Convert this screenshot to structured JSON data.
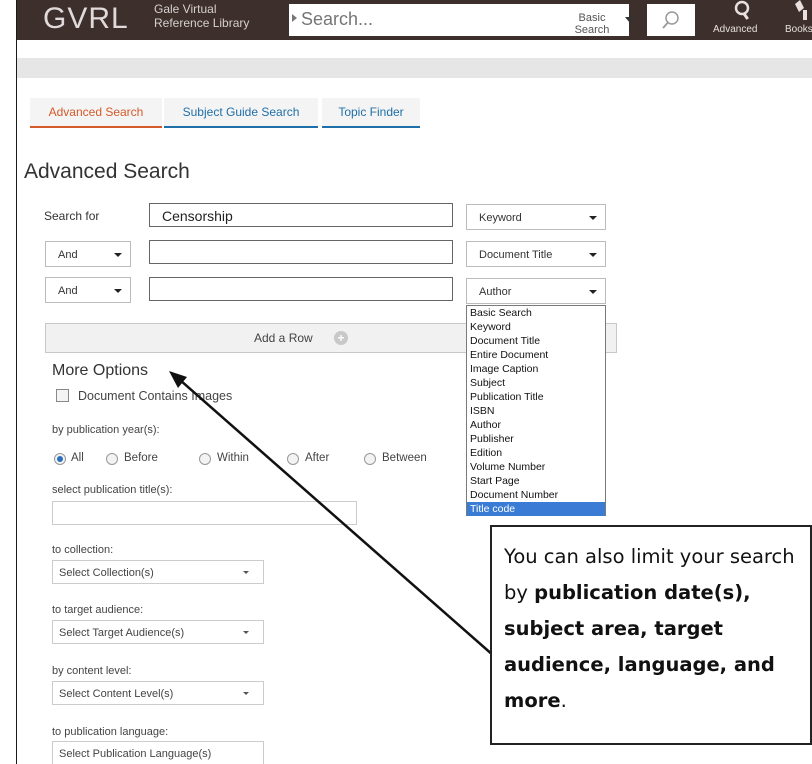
{
  "header": {
    "logo": "GVRL",
    "logo_sub_line1": "Gale Virtual",
    "logo_sub_line2": "Reference Library",
    "search_placeholder": "Search...",
    "search_type_line1": "Basic",
    "search_type_line2": "Search",
    "advanced_label": "Advanced",
    "books_label": "Books"
  },
  "tabs": [
    {
      "label": "Advanced Search"
    },
    {
      "label": "Subject Guide Search"
    },
    {
      "label": "Topic Finder"
    }
  ],
  "page_title": "Advanced Search",
  "search_rows": [
    {
      "label": "Search for",
      "value": "Censorship",
      "field_type": "Keyword"
    },
    {
      "operator": "And",
      "value": "",
      "field_type": "Document Title"
    },
    {
      "operator": "And",
      "value": "",
      "field_type": "Author"
    }
  ],
  "add_row_label": "Add a Row",
  "field_type_options": [
    "Basic Search",
    "Keyword",
    "Document Title",
    "Entire Document",
    "Image Caption",
    "Subject",
    "Publication Title",
    "ISBN",
    "Author",
    "Publisher",
    "Edition",
    "Volume Number",
    "Start Page",
    "Document Number",
    "Title code"
  ],
  "more_options": {
    "title": "More Options",
    "images_checkbox": "Document Contains Images",
    "pub_year_label": "by publication year(s):",
    "year_options": [
      "All",
      "Before",
      "Within",
      "After",
      "Between"
    ],
    "pub_title_label": "select publication title(s):",
    "collection_label": "to collection:",
    "collection_value": "Select Collection(s)",
    "audience_label": "to target audience:",
    "audience_value": "Select Target Audience(s)",
    "content_label": "by content level:",
    "content_value": "Select Content Level(s)",
    "language_label": "to publication language:",
    "language_value": "Select Publication Language(s)"
  },
  "callout": {
    "part1": "You can also limit your search by ",
    "bold1": "publication date(s), subject area, target audience, language, and more",
    "part2": "."
  },
  "colors": {
    "header_bg": "#3c2f2c",
    "active_tab": "#d45a2a",
    "tab_link": "#1f6fa8",
    "selected_option": "#3a7bd5"
  }
}
